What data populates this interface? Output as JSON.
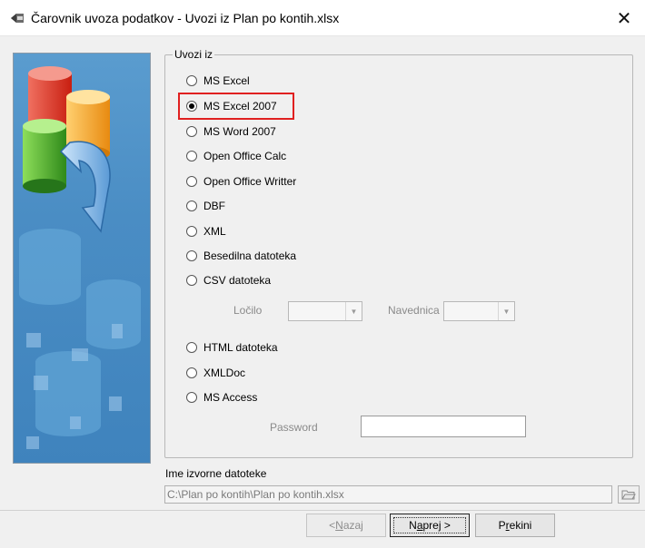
{
  "window": {
    "title": "Čarovnik uvoza podatkov - Uvozi iz Plan po kontih.xlsx",
    "icon": "pencil-icon",
    "close_glyph": "✕"
  },
  "import_group": {
    "legend": "Uvozi iz",
    "selected": "MS Excel 2007",
    "options": [
      "MS Excel",
      "MS Excel 2007",
      "MS Word 2007",
      "Open Office Calc",
      "Open Office Writter",
      "DBF",
      "XML",
      "Besedilna datoteka",
      "CSV datoteka",
      "HTML datoteka",
      "XMLDoc",
      "MS Access"
    ],
    "csv": {
      "separator_label": "Ločilo",
      "separator_value": "",
      "quote_label": "Navednica",
      "quote_value": ""
    },
    "password_label": "Password",
    "password_value": ""
  },
  "source": {
    "label": "Ime izvorne datoteke",
    "path": "C:\\Plan po kontih\\Plan po kontih.xlsx"
  },
  "buttons": {
    "back_pre": "< ",
    "back_key": "N",
    "back_post": "azaj",
    "next_pre": "N",
    "next_key": "a",
    "next_post": "prej >",
    "cancel_pre": "P",
    "cancel_key": "r",
    "cancel_post": "ekini"
  },
  "colors": {
    "highlight": "#e02020",
    "panel_blue": "#4a8dc4"
  }
}
